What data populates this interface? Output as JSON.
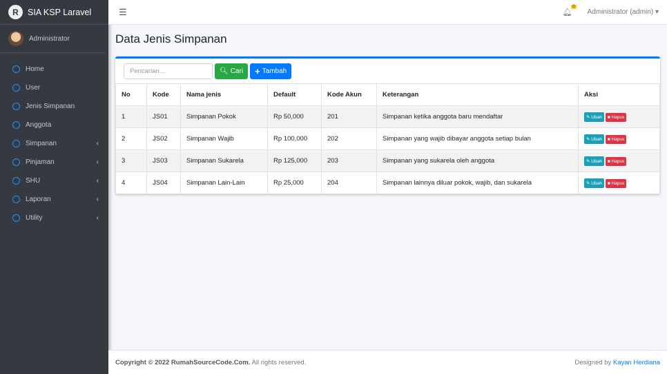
{
  "brand": "SIA KSP Laravel",
  "user": "Administrator",
  "sidebar": {
    "items": [
      {
        "label": "Home",
        "sub": false
      },
      {
        "label": "User",
        "sub": false
      },
      {
        "label": "Jenis Simpanan",
        "sub": false
      },
      {
        "label": "Anggota",
        "sub": false
      },
      {
        "label": "Simpanan",
        "sub": true
      },
      {
        "label": "Pinjaman",
        "sub": true
      },
      {
        "label": "SHU",
        "sub": true
      },
      {
        "label": "Laporan",
        "sub": true
      },
      {
        "label": "Utility",
        "sub": true
      }
    ]
  },
  "topbar": {
    "notif_count": "0",
    "account": "Administrator (admin)"
  },
  "page_title": "Data Jenis Simpanan",
  "toolbar": {
    "search_placeholder": "Pencarian...",
    "search_label": "Cari",
    "add_label": "Tambah"
  },
  "table": {
    "headers": [
      "No",
      "Kode",
      "Nama jenis",
      "Default",
      "Kode Akun",
      "Keterangan",
      "Aksi"
    ],
    "rows": [
      [
        "1",
        "JS01",
        "Simpanan Pokok",
        "Rp 50,000",
        "201",
        "Simpanan ketika anggota baru mendaftar"
      ],
      [
        "2",
        "JS02",
        "Simpanan Wajib",
        "Rp 100,000",
        "202",
        "Simpanan yang wajib dibayar anggota setiap bulan"
      ],
      [
        "3",
        "JS03",
        "Simpanan Sukarela",
        "Rp 125,000",
        "203",
        "Simpanan yang sukarela oleh anggota"
      ],
      [
        "4",
        "JS04",
        "Simpanan Lain-Lain",
        "Rp 25,000",
        "204",
        "Simpanan lainnya diluar pokok, wajib, dan sukarela"
      ]
    ],
    "edit_label": "Ubah",
    "delete_label": "Hapus"
  },
  "footer": {
    "copyright": "Copyright © 2022 RumahSourceCode.Com.",
    "rights": " All rights reserved.",
    "designed": "Designed by ",
    "author": "Kayan Herdiana"
  },
  "colors": {
    "primary": "#007bff",
    "success": "#28a745",
    "info": "#17a2b8",
    "danger": "#dc3545"
  }
}
